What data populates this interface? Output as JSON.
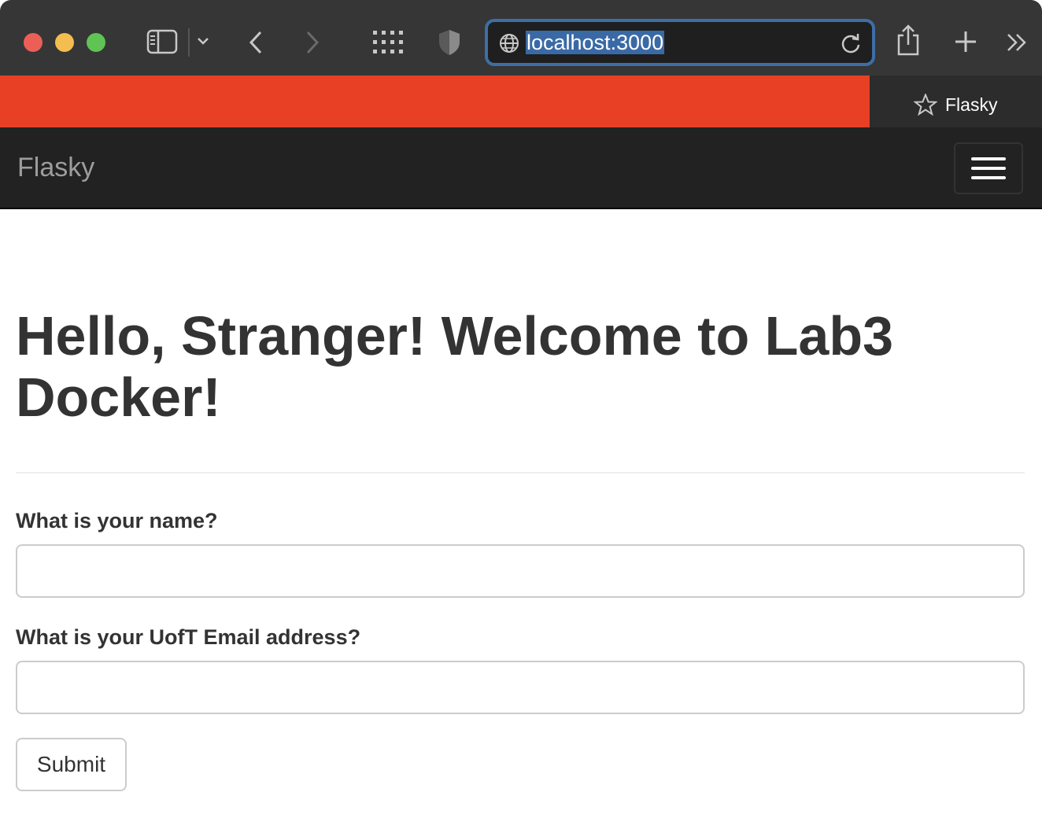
{
  "browser": {
    "url": "localhost:3000",
    "tabs": [
      {
        "title": ""
      },
      {
        "title": "Flasky"
      }
    ],
    "active_tab_color": "#e84025",
    "icons": [
      "sidebar-icon",
      "chevron-down-icon",
      "back-icon",
      "forward-icon",
      "grid-icon",
      "shield-icon",
      "globe-icon",
      "reload-icon",
      "share-icon",
      "plus-icon",
      "chevrons-right-icon",
      "star-icon"
    ]
  },
  "navbar": {
    "brand": "Flasky",
    "toggle_icon": "hamburger-icon"
  },
  "main": {
    "heading": "Hello, Stranger! Welcome to Lab3 Docker!",
    "form": {
      "name_label": "What is your name?",
      "name_value": "",
      "email_label": "What is your UofT Email address?",
      "email_value": "",
      "submit_label": "Submit"
    }
  }
}
